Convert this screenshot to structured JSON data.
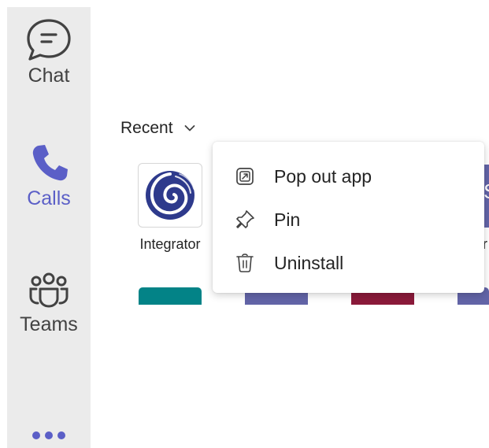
{
  "rail": {
    "items": [
      {
        "label": "Chat",
        "icon": "chat-icon",
        "active": false
      },
      {
        "label": "Calls",
        "icon": "phone-icon",
        "active": true
      },
      {
        "label": "Teams",
        "icon": "teams-icon",
        "active": false
      }
    ],
    "more_icon": "more-horizontal-icon"
  },
  "main": {
    "recent_label": "Recent",
    "apps": [
      {
        "label": "Integrator",
        "icon": "integrator-swirl-logo"
      }
    ],
    "partial_tile_right": {
      "letter": "S",
      "label": "r"
    }
  },
  "context_menu": {
    "items": [
      {
        "label": "Pop out app",
        "icon": "pop-out-icon"
      },
      {
        "label": "Pin",
        "icon": "pin-icon"
      },
      {
        "label": "Uninstall",
        "icon": "trash-icon"
      }
    ]
  },
  "colors": {
    "accent": "#5b5fc7",
    "rail_bg": "#ebebeb",
    "tile_teal": "#038387",
    "tile_purple": "#6264a7",
    "tile_maroon": "#8b1a3a"
  }
}
